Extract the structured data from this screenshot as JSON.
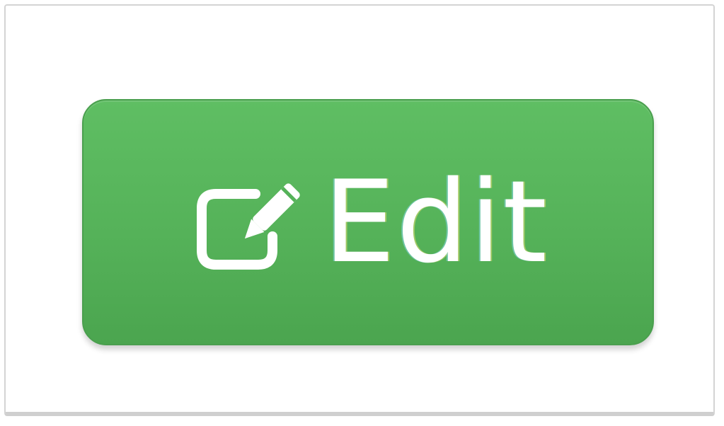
{
  "button": {
    "label": "Edit",
    "icon": "edit-icon",
    "color": "#5cb85c"
  }
}
